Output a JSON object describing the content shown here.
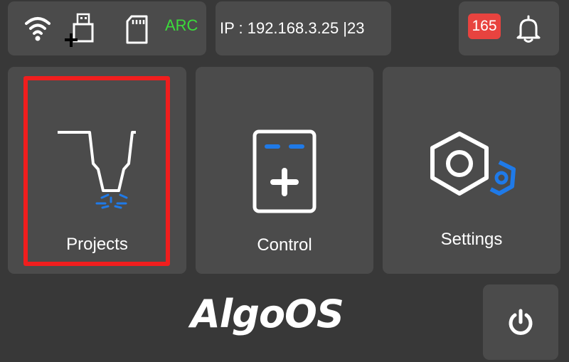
{
  "status_bar": {
    "icons": [
      "wifi-icon",
      "usb-add-icon",
      "sd-card-icon"
    ],
    "mode_label": "ARC",
    "mode_color": "#3bdc3b",
    "ip_text": "IP : 192.168.3.25 |23",
    "notification_count": "165",
    "badge_color": "#e8433f"
  },
  "tiles": [
    {
      "label": "Projects",
      "icon": "laser-head-icon",
      "selected": true
    },
    {
      "label": "Control",
      "icon": "control-panel-icon",
      "selected": false
    },
    {
      "label": "Settings",
      "icon": "gear-icon",
      "selected": false
    }
  ],
  "brand": "AlgoOS",
  "power_icon": "power-icon",
  "colors": {
    "background": "#383838",
    "panel": "#4b4b4b",
    "accent_blue": "#1f7ae8",
    "selection_red": "#f01e1e"
  }
}
